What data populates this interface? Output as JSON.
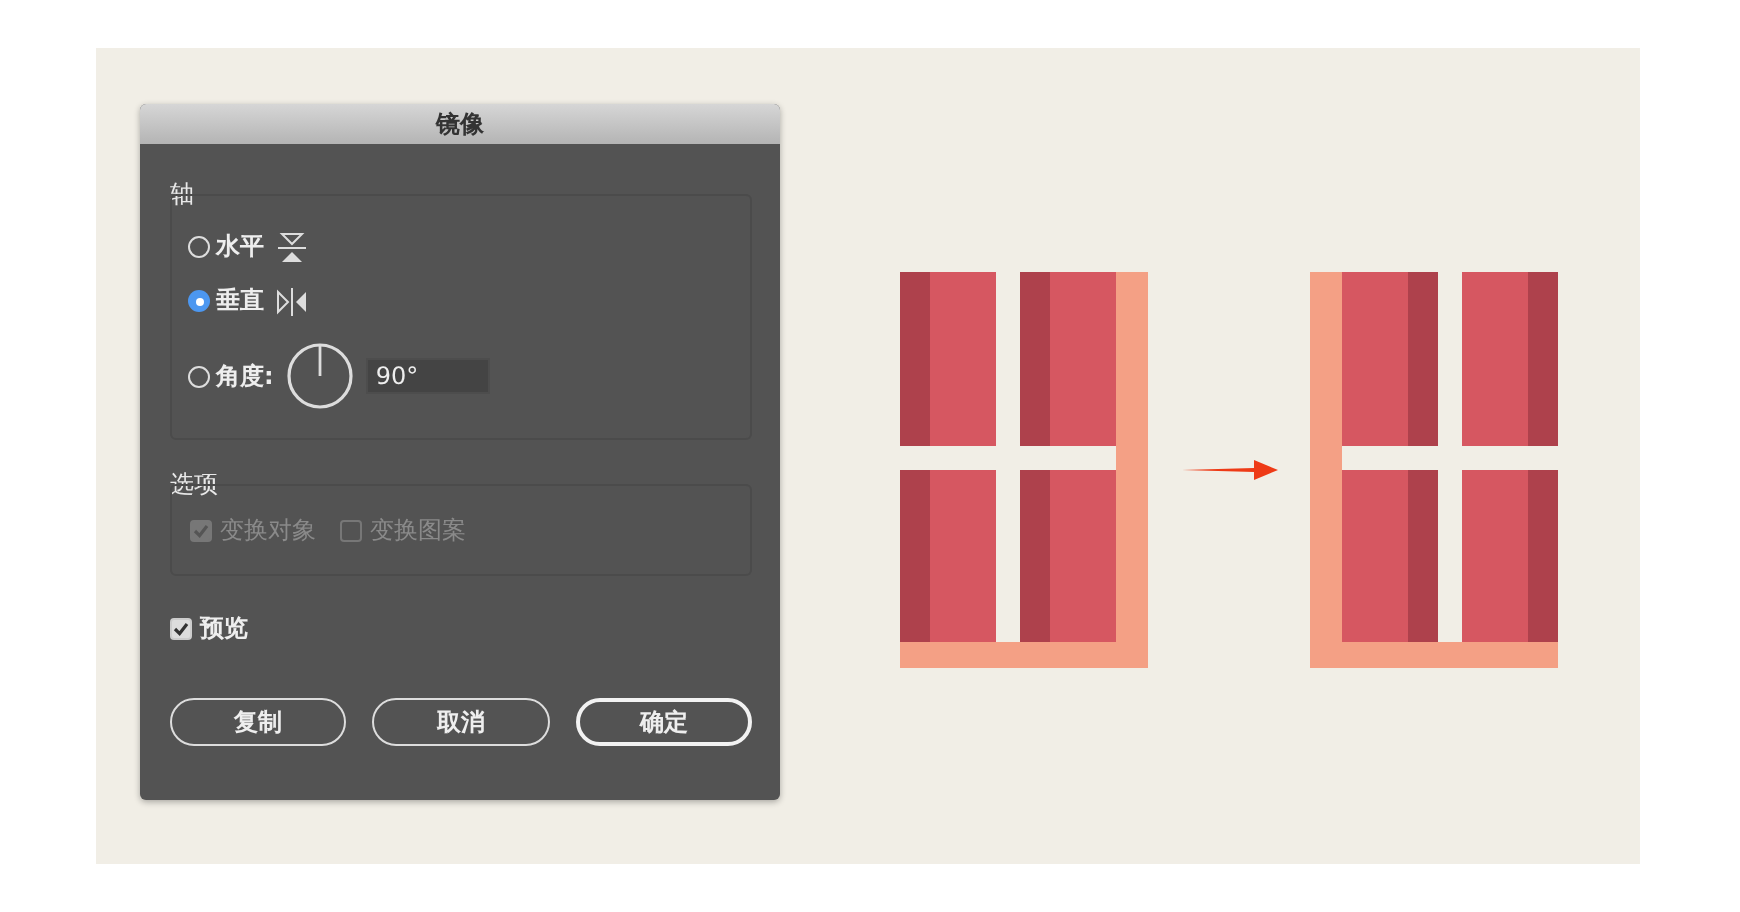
{
  "dialog": {
    "title": "镜像",
    "axis": {
      "label": "轴",
      "options": [
        {
          "kind": "horizontal",
          "label": "水平",
          "selected": false
        },
        {
          "kind": "vertical",
          "label": "垂直",
          "selected": true
        },
        {
          "kind": "angle",
          "label": "角度:",
          "selected": false,
          "value": "90°"
        }
      ]
    },
    "options": {
      "label": "选项",
      "checkboxes": [
        {
          "label": "变换对象",
          "checked": true,
          "disabled": true
        },
        {
          "label": "变换图案",
          "checked": false,
          "disabled": true
        }
      ]
    },
    "preview": {
      "label": "预览",
      "checked": true
    },
    "buttons": [
      {
        "label": "复制",
        "default": false
      },
      {
        "label": "取消",
        "default": false
      },
      {
        "label": "确定",
        "default": true
      }
    ]
  }
}
